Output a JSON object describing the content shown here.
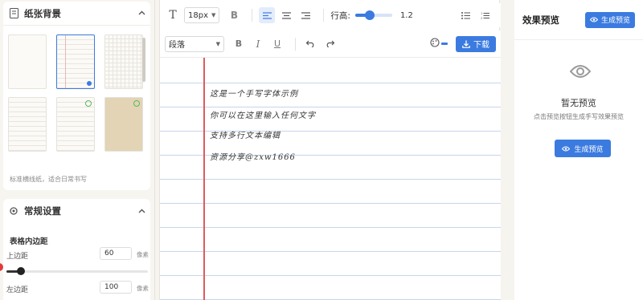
{
  "left": {
    "paper_section": {
      "title": "纸张背景",
      "description": "标准横线纸，适合日常书写"
    },
    "settings_section": {
      "title": "常规设置",
      "group_title": "表格内边距",
      "top_margin_label": "上边距",
      "top_margin_value": "60",
      "top_margin_unit": "像素",
      "top_margin_slider_fraction": 0.1,
      "left_margin_label": "左边距",
      "left_margin_value": "100",
      "left_margin_unit": "像素"
    }
  },
  "toolbar": {
    "font_size": "18px",
    "bold": "B",
    "line_height_label": "行高:",
    "line_height_value": "1.2",
    "paragraph_select": "段落",
    "download_label": "下载"
  },
  "editor": {
    "lines": [
      "这是一个手写字体示例",
      "你可以在这里输入任何文字",
      "支持多行文本编辑",
      "资源分享@zxw1666"
    ]
  },
  "preview": {
    "title": "效果预览",
    "header_button": "生成预览",
    "empty_title": "暂无预览",
    "empty_hint": "点击预览按钮生成手写效果预览",
    "generate_button": "生成预览"
  },
  "colors": {
    "accent": "#3b7be0",
    "margin_line": "#e05b5b"
  }
}
